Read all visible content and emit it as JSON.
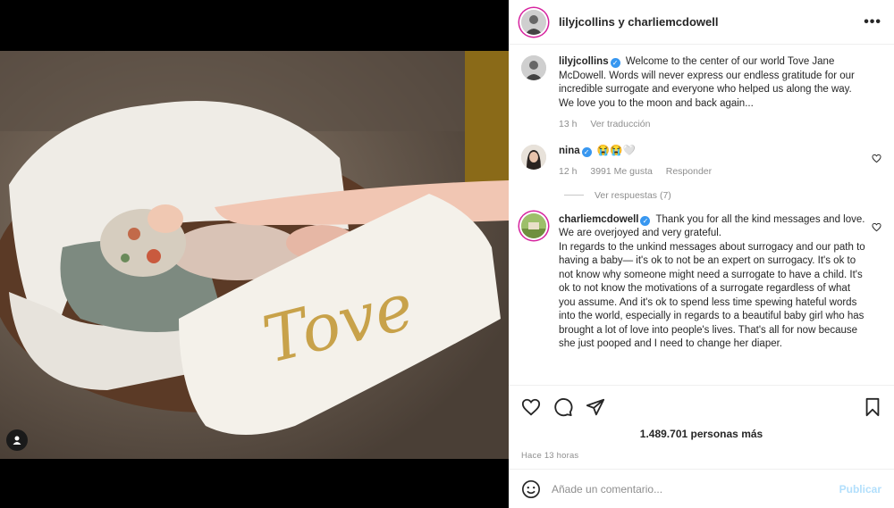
{
  "header": {
    "title": "lilyjcollins y charliemcdowell",
    "more_label": "•••"
  },
  "photo": {
    "embroidered_text": "Tove"
  },
  "caption": {
    "username": "lilyjcollins",
    "text": "Welcome to the center of our world Tove Jane McDowell. Words will never express our endless gratitude for our incredible surrogate and everyone who helped us along the way. We love you to the moon and back again...",
    "time": "13 h",
    "translate_label": "Ver traducción"
  },
  "comments": [
    {
      "username": "nina",
      "text": "😭😭🤍",
      "time": "12 h",
      "likes": "3991 Me gusta",
      "reply_label": "Responder",
      "view_replies": "Ver respuestas (7)"
    },
    {
      "username": "charliemcdowell",
      "text": "Thank you for all the kind messages and love. We are overjoyed and very grateful.",
      "text2": "In regards to the unkind messages about surrogacy and our path to having a baby— it's ok to not be an expert on surrogacy. It's ok to not know why someone might need a surrogate to have a child. It's ok to not know the motivations of a surrogate regardless of what you assume. And it's ok to spend less time spewing hateful words into the world, especially in regards to a beautiful baby girl who has brought a lot of love into people's lives. That's all for now because she just pooped and I need to change her diaper."
    }
  ],
  "stats": {
    "likes": "1.489.701 personas más",
    "time": "Hace 13 horas"
  },
  "add_comment": {
    "placeholder": "Añade un comentario...",
    "post_label": "Publicar"
  },
  "icons": {
    "verified": "✓"
  },
  "colors": {
    "verified": "#3897f0",
    "post_disabled": "#b2dffc",
    "secondary_text": "#8e8e8e"
  }
}
